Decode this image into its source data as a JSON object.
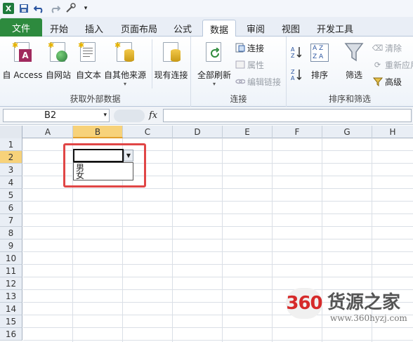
{
  "tabs": [
    "文件",
    "开始",
    "插入",
    "页面布局",
    "公式",
    "数据",
    "审阅",
    "视图",
    "开发工具"
  ],
  "ribbon": {
    "get_external": {
      "label": "获取外部数据",
      "buttons": [
        "自 Access",
        "自网站",
        "自文本",
        "自其他来源",
        "现有连接"
      ]
    },
    "connections": {
      "label": "连接",
      "refresh_all": "全部刷新",
      "connect": "连接",
      "properties": "属性",
      "edit_links": "编辑链接"
    },
    "sort_filter": {
      "label": "排序和筛选",
      "sort": "排序",
      "filter": "筛选",
      "clear": "清除",
      "reapply": "重新应用",
      "advanced": "高级"
    }
  },
  "formula_bar": {
    "name_box": "B2",
    "fx": "fx",
    "formula": ""
  },
  "columns": [
    "A",
    "B",
    "C",
    "D",
    "E",
    "F",
    "G",
    "H"
  ],
  "rows": [
    "1",
    "2",
    "3",
    "4",
    "5",
    "6",
    "7",
    "8",
    "9",
    "10",
    "11",
    "12",
    "13",
    "14",
    "15",
    "16"
  ],
  "active_cell": "B2",
  "dropdown_options": [
    "男",
    "女"
  ],
  "watermark": {
    "badge": "360",
    "name": "货源之家",
    "url": "www.360hyzj.com"
  }
}
